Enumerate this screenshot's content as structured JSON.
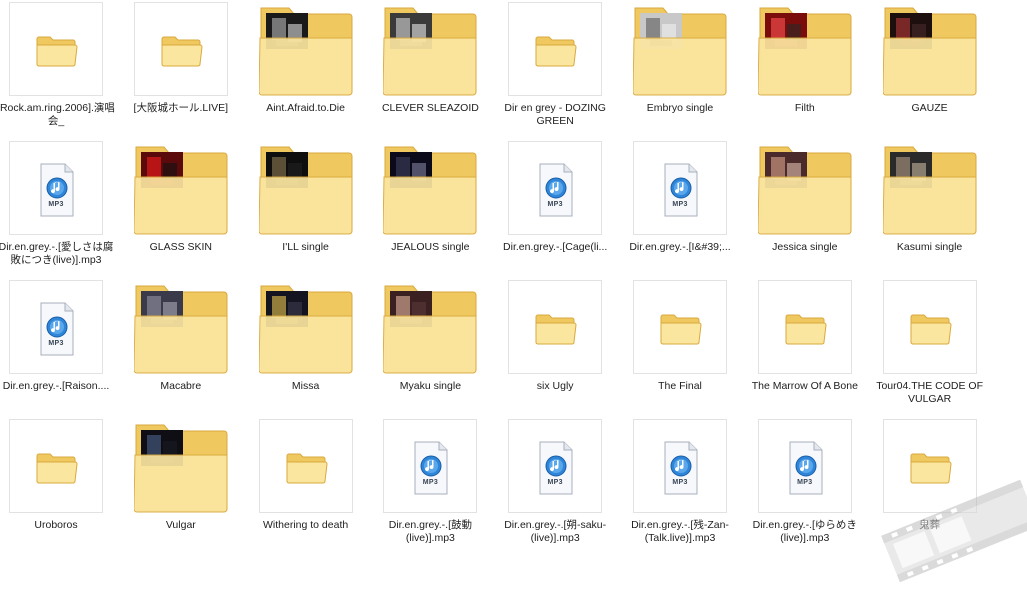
{
  "colors": {
    "folder_back": "#f0c860",
    "folder_front": "#fbe6a0",
    "folder_edge": "#d9a93c",
    "mp3_badge": "#2f86d8"
  },
  "icon_names": {
    "folder": "folder-icon",
    "mp3": "mp3-file-icon",
    "album_folder": "album-art-folder-icon"
  },
  "mp3_badge_text": "MP3",
  "items": [
    {
      "label": "[Rock.am.ring.2006].演唱会_",
      "type": "folder"
    },
    {
      "label": "[大阪城ホール.LIVE]",
      "type": "folder"
    },
    {
      "label": "Aint.Afraid.to.Die",
      "type": "art",
      "art": [
        "#1a1a1a",
        "#888888",
        "#dcdcdc"
      ]
    },
    {
      "label": "CLEVER SLEAZOID",
      "type": "art",
      "art": [
        "#3a3a3a",
        "#a9a9a9",
        "#e8e8e8"
      ]
    },
    {
      "label": "Dir en grey - DOZING GREEN",
      "type": "folder"
    },
    {
      "label": "Embryo single",
      "type": "art",
      "art": [
        "#c8c8c8",
        "#7a7a7a",
        "#f0f0f0"
      ]
    },
    {
      "label": "Filth",
      "type": "art",
      "art": [
        "#7a0c0c",
        "#d94040",
        "#2a2a2a"
      ]
    },
    {
      "label": "GAUZE",
      "type": "art",
      "art": [
        "#1e0f0f",
        "#8a2b2b",
        "#4a2a2a"
      ]
    },
    {
      "label": "Dir.en.grey.-.[愛しさは腐敗につき(live)].mp3",
      "type": "mp3"
    },
    {
      "label": "GLASS SKIN",
      "type": "art",
      "art": [
        "#5a0a0a",
        "#c81818",
        "#101010"
      ]
    },
    {
      "label": "I'LL single",
      "type": "art",
      "art": [
        "#0e0e0e",
        "#6a5a40",
        "#222222"
      ]
    },
    {
      "label": "JEALOUS single",
      "type": "art",
      "art": [
        "#0a0a1a",
        "#30304a",
        "#8080a0"
      ]
    },
    {
      "label": "Dir.en.grey.-.[Cage(li...",
      "type": "mp3"
    },
    {
      "label": "Dir.en.grey.-.[I&#39;...",
      "type": "mp3"
    },
    {
      "label": "Jessica single",
      "type": "art",
      "art": [
        "#4a2a2a",
        "#b08070",
        "#e0c0b0"
      ]
    },
    {
      "label": "Kasumi single",
      "type": "art",
      "art": [
        "#2a2a2a",
        "#8a7a6a",
        "#c8b8a0"
      ]
    },
    {
      "label": "Dir.en.grey.-.[Raison....",
      "type": "mp3"
    },
    {
      "label": "Macabre",
      "type": "art",
      "art": [
        "#3a3a4a",
        "#7a7a8a",
        "#a8a8b8"
      ]
    },
    {
      "label": "Missa",
      "type": "art",
      "art": [
        "#141420",
        "#a89040",
        "#3a3a50"
      ]
    },
    {
      "label": "Myaku single",
      "type": "art",
      "art": [
        "#3a2020",
        "#b08a7a",
        "#5a3a3a"
      ]
    },
    {
      "label": "six Ugly",
      "type": "folder"
    },
    {
      "label": "The Final",
      "type": "folder"
    },
    {
      "label": "The Marrow Of A Bone",
      "type": "folder"
    },
    {
      "label": "Tour04.THE CODE OF VULGAR",
      "type": "folder"
    },
    {
      "label": "Uroboros",
      "type": "folder"
    },
    {
      "label": "Vulgar",
      "type": "art",
      "art": [
        "#0e0e14",
        "#3a4a6a",
        "#1a1a24"
      ]
    },
    {
      "label": "Withering to death",
      "type": "folder"
    },
    {
      "label": "Dir.en.grey.-.[鼓動(live)].mp3",
      "type": "mp3"
    },
    {
      "label": "Dir.en.grey.-.[朔-saku-(live)].mp3",
      "type": "mp3"
    },
    {
      "label": "Dir.en.grey.-.[残-Zan-(Talk.live)].mp3",
      "type": "mp3"
    },
    {
      "label": "Dir.en.grey.-.[ゆらめき(live)].mp3",
      "type": "mp3"
    },
    {
      "label": "鬼葬",
      "type": "folder"
    }
  ]
}
